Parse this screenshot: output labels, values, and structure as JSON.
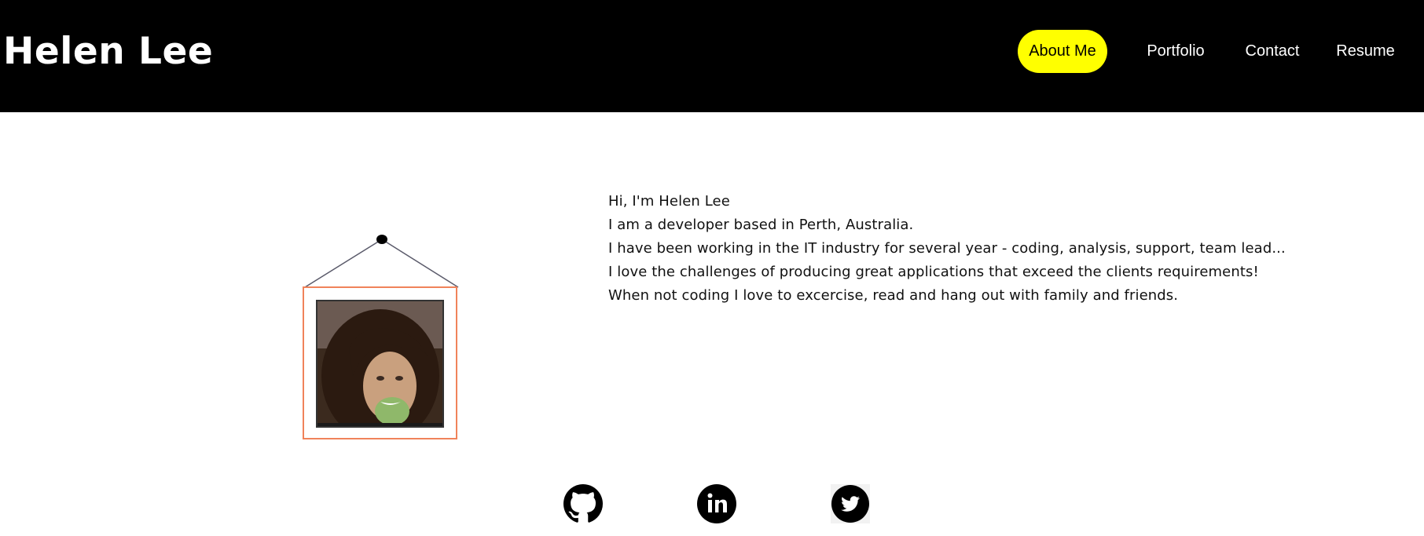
{
  "header": {
    "title": "Helen Lee",
    "nav": [
      {
        "label": "About Me",
        "active": true
      },
      {
        "label": "Portfolio",
        "active": false
      },
      {
        "label": "Contact",
        "active": false
      },
      {
        "label": "Resume",
        "active": false
      }
    ]
  },
  "about": {
    "lines": [
      "Hi, I'm Helen Lee",
      "I am a developer based in Perth, Australia.",
      "I have been working in the IT industry for several year - coding, analysis, support, team lead...",
      "I love the challenges of producing great applications that exceed the clients requirements!",
      "When not coding I love to excercise, read and hang out with family and friends."
    ]
  },
  "social": [
    {
      "icon": "github-icon"
    },
    {
      "icon": "linkedin-icon"
    },
    {
      "icon": "twitter-icon"
    }
  ],
  "colors": {
    "header_bg": "#000000",
    "nav_active_bg": "#ffff00",
    "frame_border": "#f0835a",
    "text": "#111111"
  }
}
